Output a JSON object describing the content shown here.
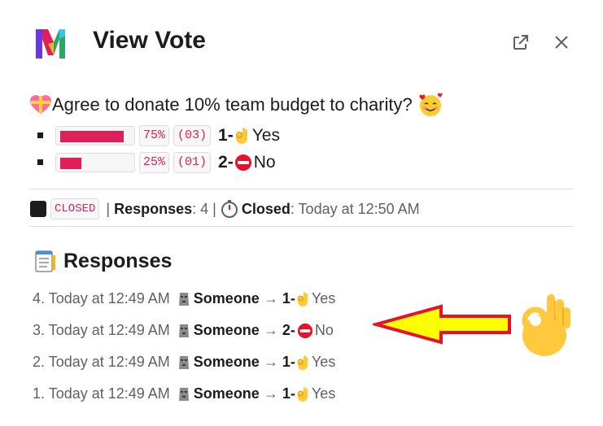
{
  "header": {
    "title": "View Vote"
  },
  "poll": {
    "question": "Agree to donate 10% team budget to charity?",
    "options": [
      {
        "percent_label": "75%",
        "count_label": "(03)",
        "number": "1-",
        "label": "Yes",
        "fraction": 0.75
      },
      {
        "percent_label": "25%",
        "count_label": "(01)",
        "number": "2-",
        "label": "No",
        "fraction": 0.25
      }
    ]
  },
  "status": {
    "state": "CLOSED",
    "sep1": "|",
    "responses_label": "Responses",
    "responses_value": ": 4",
    "sep2": "|",
    "closed_label": "Closed",
    "closed_value": ": Today at 12:50 AM"
  },
  "responses": {
    "title": "Responses",
    "items": [
      {
        "prefix": "4. Today at 12:49 AM",
        "user": "Someone",
        "arrow": "→",
        "choice_num": "1-",
        "choice": "Yes"
      },
      {
        "prefix": "3. Today at 12:49 AM",
        "user": "Someone",
        "arrow": "→",
        "choice_num": "2-",
        "choice": "No"
      },
      {
        "prefix": "2. Today at 12:49 AM",
        "user": "Someone",
        "arrow": "→",
        "choice_num": "1-",
        "choice": "Yes"
      },
      {
        "prefix": "1. Today at 12:49 AM",
        "user": "Someone",
        "arrow": "→",
        "choice_num": "1-",
        "choice": "Yes"
      }
    ]
  },
  "colors": {
    "accent": "#e01e5a",
    "arrow_fill": "#ffff00",
    "arrow_stroke": "#e8102a",
    "text": "#1d1c1d",
    "muted": "#616061"
  },
  "icons": [
    "app-logo-icon",
    "external-link-icon",
    "close-icon",
    "heart-gift-icon",
    "smiling-hearts-icon",
    "ok-hand-icon",
    "no-entry-icon",
    "stop-square-icon",
    "stopwatch-icon",
    "notepad-icon",
    "moai-icon"
  ]
}
